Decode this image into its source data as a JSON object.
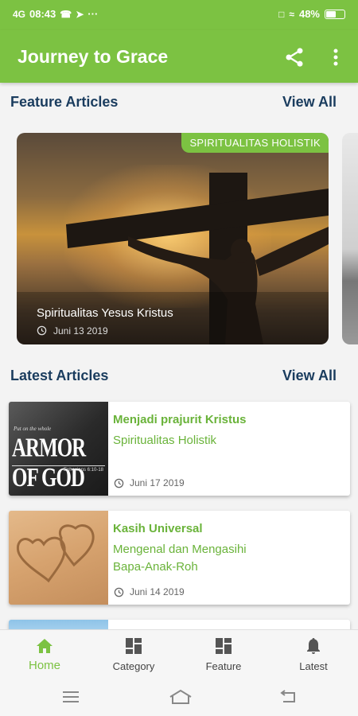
{
  "status_bar": {
    "signal": "4G",
    "time": "08:43",
    "more": "···",
    "battery": "48%",
    "battery_level": 0.48
  },
  "app_bar": {
    "title": "Journey to Grace",
    "share_icon": "share-icon",
    "more_icon": "more-vert-icon"
  },
  "feature_section": {
    "title": "Feature Articles",
    "view_all": "View All",
    "card": {
      "tag": "SPIRITUALITAS HOLISTIK",
      "title": "Spiritualitas Yesus Kristus",
      "date": "Juni 13 2019"
    }
  },
  "latest_section": {
    "title": "Latest Articles",
    "view_all": "View All",
    "articles": [
      {
        "title": "Menjadi prajurit Kristus",
        "category": "Spiritualitas Holistik",
        "date": "Juni 17 2019",
        "thumb": {
          "top": "Put on the whole",
          "main": "ARMOR OF GOD",
          "ref": "Ephesians 6:10-18"
        }
      },
      {
        "title": "Kasih Universal",
        "category": "Mengenal dan Mengasihi Bapa-Anak-Roh",
        "date": "Juni 14 2019"
      }
    ]
  },
  "bottom_nav": [
    {
      "label": "Home",
      "icon": "home-icon",
      "active": true
    },
    {
      "label": "Category",
      "icon": "category-grid-icon",
      "active": false
    },
    {
      "label": "Feature",
      "icon": "feature-grid-icon",
      "active": false
    },
    {
      "label": "Latest",
      "icon": "bell-icon",
      "active": false
    }
  ],
  "colors": {
    "brand_green": "#7cc242",
    "article_green": "#6ab33a",
    "heading_navy": "#1a3c5e"
  }
}
